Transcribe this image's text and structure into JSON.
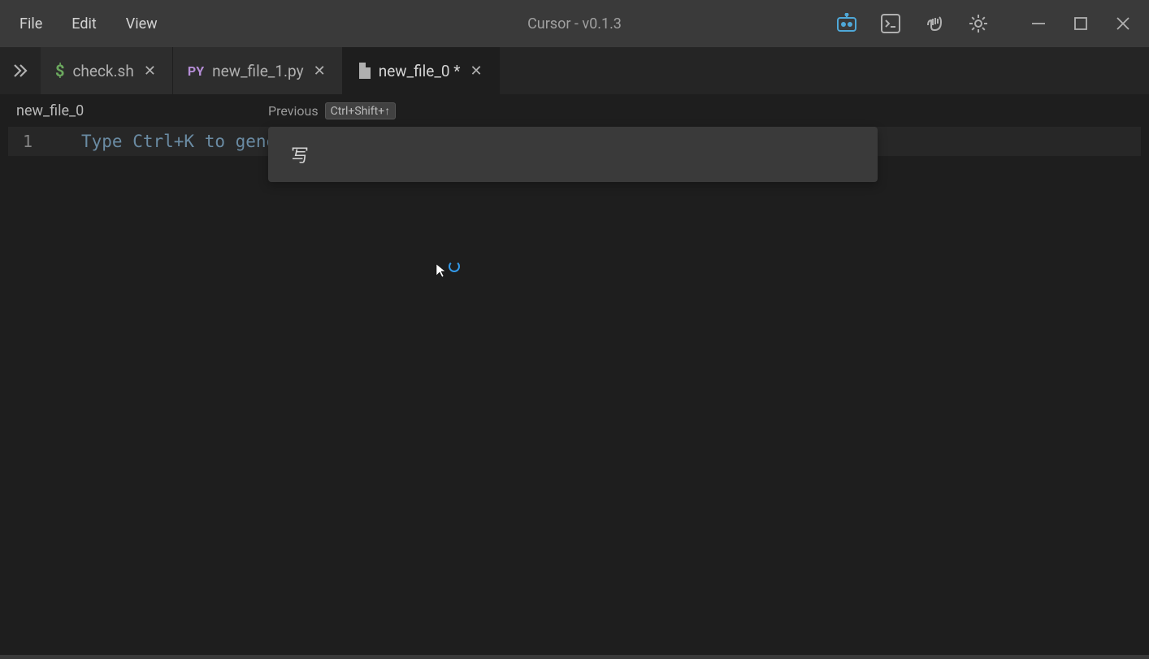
{
  "menu": {
    "file": "File",
    "edit": "Edit",
    "view": "View"
  },
  "title": "Cursor - v0.1.3",
  "tabs": [
    {
      "label": "check.sh",
      "icon": "dollar",
      "modified": false
    },
    {
      "label": "new_file_1.py",
      "icon": "py",
      "modified": false
    },
    {
      "label": "new_file_0 *",
      "icon": "file",
      "modified": true,
      "active": true
    }
  ],
  "breadcrumb": "new_file_0",
  "prev_hint": {
    "label": "Previous",
    "shortcut": "Ctrl+Shift+↑"
  },
  "editor": {
    "line_number": "1",
    "placeholder": "Type Ctrl+K to generat"
  },
  "prompt": {
    "value": "写"
  },
  "icons": {
    "dollar": "$",
    "py": "PY"
  }
}
